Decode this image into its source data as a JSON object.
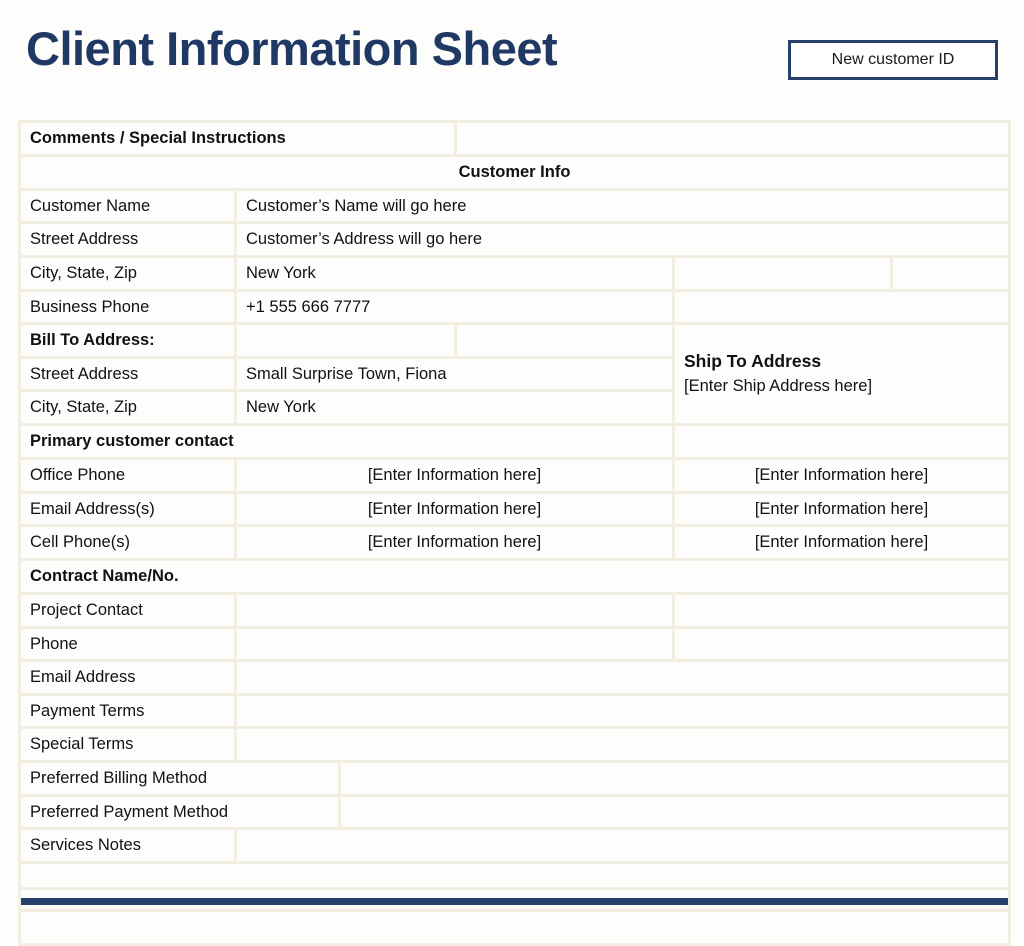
{
  "header": {
    "title": "Client Information Sheet",
    "id_button_label": "New customer ID",
    "title_color": "#1F3864",
    "accent_color": "#27406B"
  },
  "sheet": {
    "comments_label": "Comments / Special Instructions",
    "customer_info_heading": "Customer Info",
    "customer": {
      "name_label": "Customer Name",
      "name_value": "Customer’s Name will go here",
      "street_label": "Street Address",
      "street_value": "Customer’s Address will go here",
      "city_label": "City, State, Zip",
      "city_value": "New York",
      "phone_label": "Business Phone",
      "phone_value": "+1 555 666 7777"
    },
    "bill_to": {
      "label": "Bill To Address:",
      "street_label": "Street Address",
      "street_value": "Small Surprise Town, Fiona",
      "city_label": "City, State, Zip",
      "city_value": "New York"
    },
    "ship_to": {
      "title": "Ship To Address",
      "placeholder": "[Enter Ship Address here]"
    },
    "primary_contact": {
      "heading": "Primary customer contact",
      "rows": [
        {
          "label": "Office Phone",
          "col2": "[Enter Information here]",
          "col3": "[Enter Information here]"
        },
        {
          "label": "Email Address(s)",
          "col2": "[Enter Information here]",
          "col3": "[Enter Information here]"
        },
        {
          "label": "Cell Phone(s)",
          "col2": "[Enter Information here]",
          "col3": "[Enter Information here]"
        }
      ]
    },
    "contract": {
      "heading": "Contract Name/No.",
      "project_contact_label": "Project Contact",
      "project_contact_value": "",
      "phone_label": "Phone",
      "phone_value": "",
      "email_label": "Email Address",
      "email_value": "",
      "payment_terms_label": "Payment Terms",
      "payment_terms_value": "",
      "special_terms_label": "Special Terms",
      "special_terms_value": "",
      "pref_billing_label": "Preferred Billing Method",
      "pref_billing_value": "",
      "pref_payment_label": "Preferred Payment Method",
      "pref_payment_value": "",
      "services_notes_label": "Services Notes",
      "services_notes_value": ""
    }
  }
}
